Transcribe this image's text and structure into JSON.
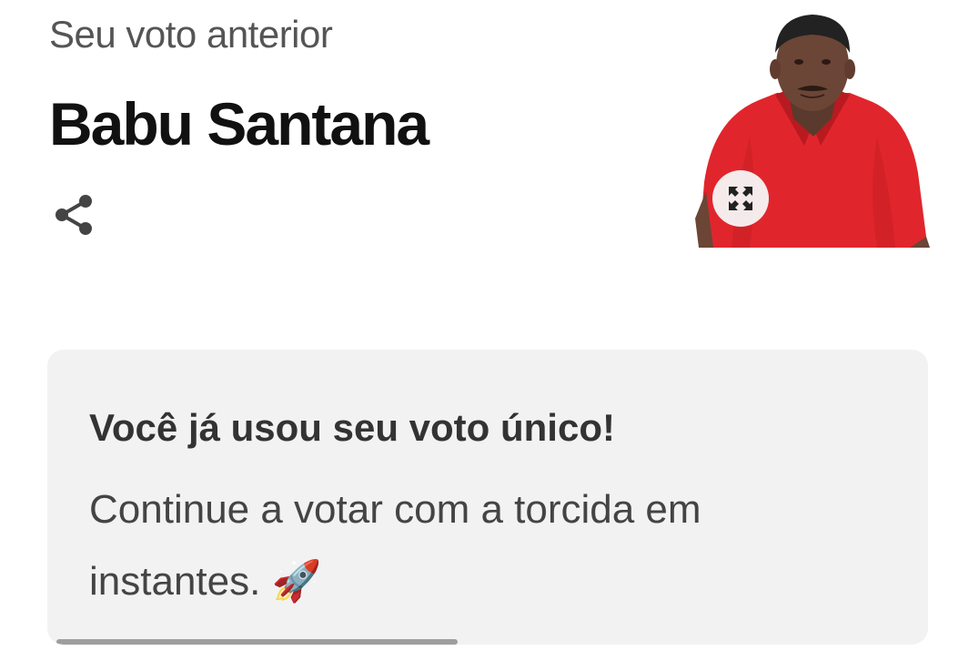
{
  "previous_vote": {
    "label": "Seu voto anterior",
    "candidate_name": "Babu Santana"
  },
  "icons": {
    "share": "share-icon",
    "expand": "expand-icon",
    "rocket": "rocket-icon"
  },
  "notice": {
    "title": "Você já usou seu voto único!",
    "message": "Continue a votar com a torcida em instantes.",
    "emoji": "🚀",
    "progress": 0.46
  },
  "colors": {
    "shirt": "#e0262c",
    "card_bg": "#f2f2f2",
    "progress": "#9e9e9e"
  }
}
